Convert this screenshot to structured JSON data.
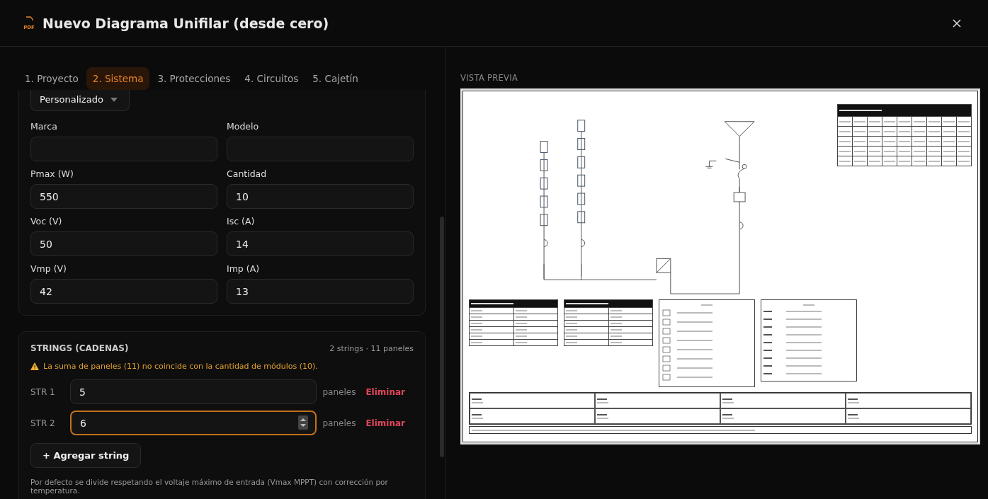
{
  "window": {
    "icon_text": "PDF",
    "title": "Nuevo Diagrama Unifilar (desde cero)"
  },
  "tabs": [
    {
      "label": "1. Proyecto",
      "selected": false
    },
    {
      "label": "2. Sistema",
      "selected": true
    },
    {
      "label": "3. Protecciones",
      "selected": false
    },
    {
      "label": "4. Circuitos",
      "selected": false
    },
    {
      "label": "5. Cajetín",
      "selected": false
    }
  ],
  "module": {
    "preset": "Personalizado",
    "fields": [
      {
        "label": "Marca"
      },
      {
        "label": "Modelo"
      },
      {
        "label": "Pmax (W)",
        "value": "550"
      },
      {
        "label": "Cantidad",
        "value": "10"
      },
      {
        "label": "Voc (V)",
        "value": "50"
      },
      {
        "label": "Isc (A)",
        "value": "14"
      },
      {
        "label": "Vmp (V)",
        "value": "42"
      },
      {
        "label": "Imp (A)",
        "value": "13"
      }
    ]
  },
  "strings": {
    "title": "STRINGS (CADENAS)",
    "summary": "2 strings · 11 paneles",
    "warning": "La suma de paneles (11) no coincide con la cantidad de módulos (10).",
    "items": [
      {
        "label": "STR 1",
        "value": "5",
        "unit": "paneles",
        "remove": "Eliminar",
        "focused": false
      },
      {
        "label": "STR 2",
        "value": "6",
        "unit": "paneles",
        "remove": "Eliminar",
        "focused": true
      }
    ],
    "add": "+ Agregar string",
    "note": "Por defecto se divide respetando el voltaje máximo de entrada (Vmax MPPT) con corrección por temperatura."
  },
  "preview": {
    "label": "VISTA PREVIA"
  }
}
